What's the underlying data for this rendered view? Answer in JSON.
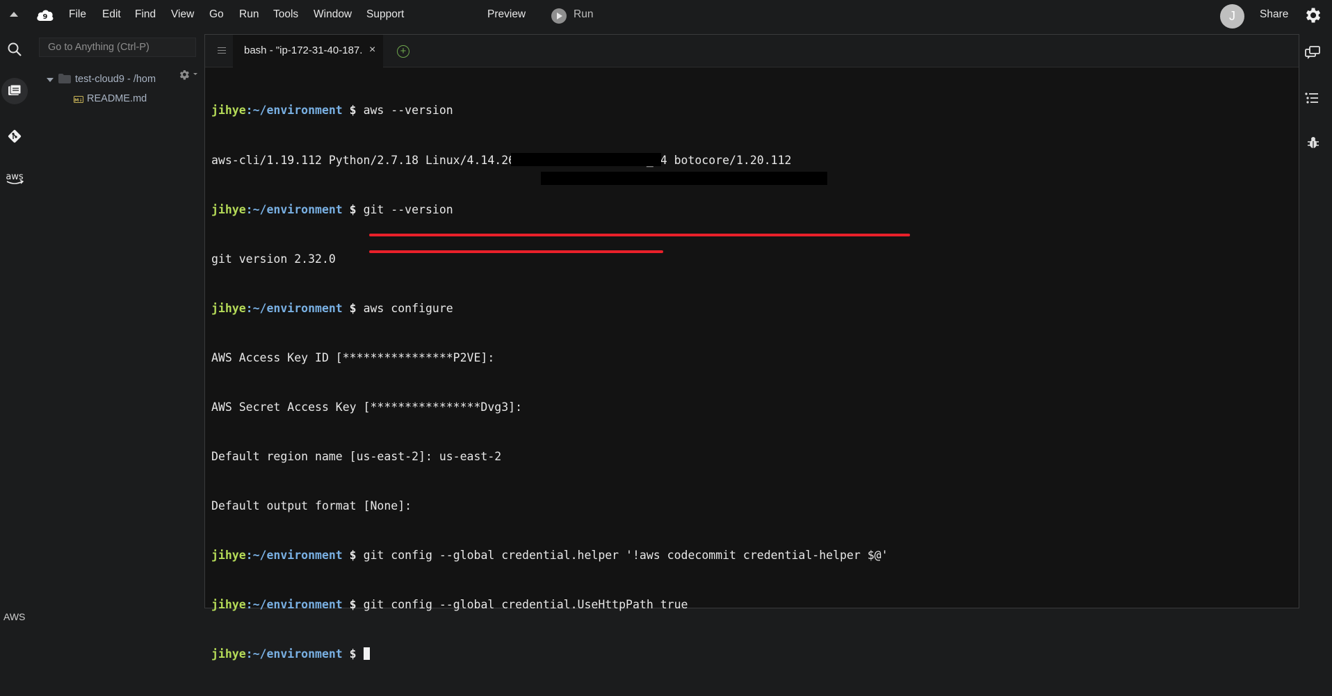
{
  "menu": {
    "items": [
      "File",
      "Edit",
      "Find",
      "View",
      "Go",
      "Run",
      "Tools",
      "Window",
      "Support"
    ],
    "preview": "Preview",
    "run": "Run",
    "avatar_initial": "J",
    "share": "Share"
  },
  "sidebar": {
    "goto_placeholder": "Go to Anything (Ctrl-P)",
    "project": "test-cloud9 - /hom",
    "file": "README.md"
  },
  "editor": {
    "tab_label": "bash - \"ip-172-31-40-187.",
    "tab_close": "×",
    "add_tab": "+"
  },
  "terminal": {
    "user": "jihye",
    "path": ":~/environment",
    "dollar": " $ ",
    "commands": [
      "aws --version",
      "git --version",
      "aws configure",
      "git config --global credential.helper '!aws codecommit credential-helper $@'",
      "git config --global credential.UseHttpPath true"
    ],
    "outputs": [
      "aws-cli/1.19.112 Python/2.7.18 Linux/4.14.268-205.500.amzn2.x86_64 botocore/1.20.112",
      "git version 2.32.0",
      "AWS Access Key ID [****************P2VE]:",
      "AWS Secret Access Key [****************Dvg3]:",
      "Default region name [us-east-2]: us-east-2",
      "Default output format [None]:"
    ]
  },
  "status": {
    "label": "AWS"
  },
  "colors": {
    "prompt_user": "#b5db58",
    "prompt_path": "#79b0e3",
    "highlight": "#e8202a",
    "background": "#131313"
  }
}
